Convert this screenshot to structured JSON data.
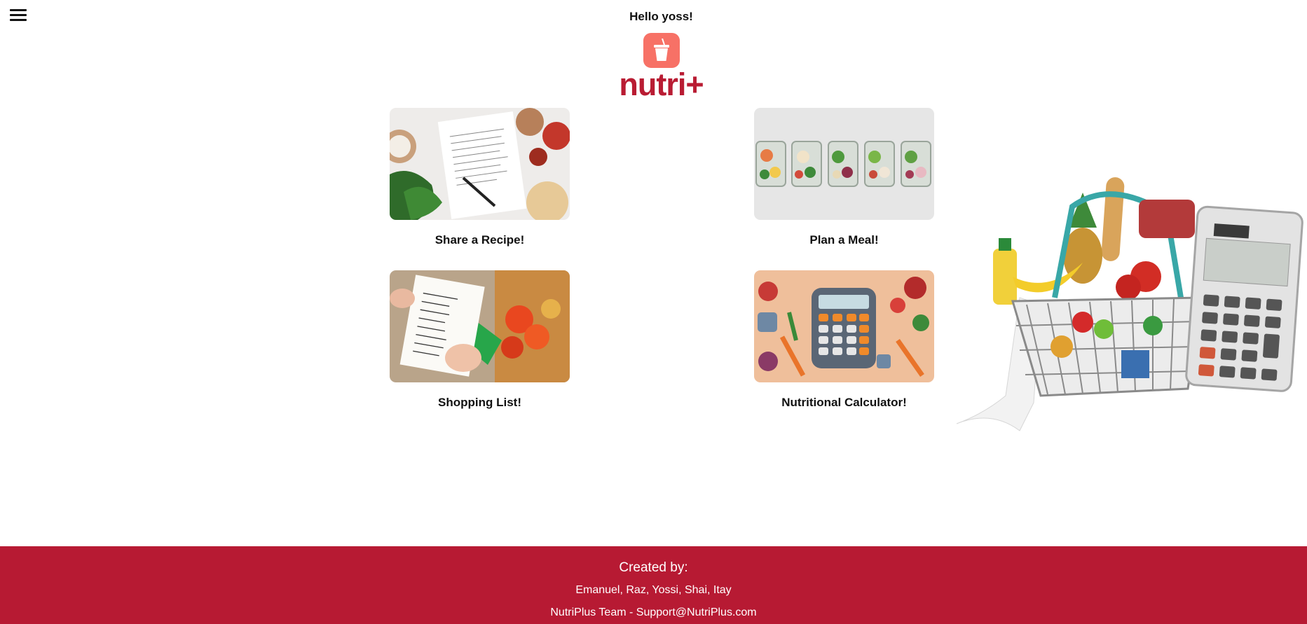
{
  "header": {
    "menu_icon": "hamburger-icon",
    "greeting": "Hello yoss!",
    "logo_icon": "drink-cup-icon",
    "logo_text": "nutri+"
  },
  "cards": [
    {
      "label": "Share a Recipe!",
      "image": "recipe-notebook-image"
    },
    {
      "label": "Plan a Meal!",
      "image": "meal-prep-containers-image"
    },
    {
      "label": "Shopping List!",
      "image": "shopping-list-image"
    },
    {
      "label": "Nutritional Calculator!",
      "image": "nutrition-calculator-image"
    }
  ],
  "hero_image": "grocery-basket-calculator-image",
  "footer": {
    "created_by": "Created by:",
    "names": "Emanuel, Raz, Yossi, Shai, Itay",
    "contact": "NutriPlus Team - Support@NutriPlus.com"
  },
  "colors": {
    "brand": "#b91c33",
    "footer_bg": "#b71a33",
    "logo_bg": "#f77166"
  }
}
